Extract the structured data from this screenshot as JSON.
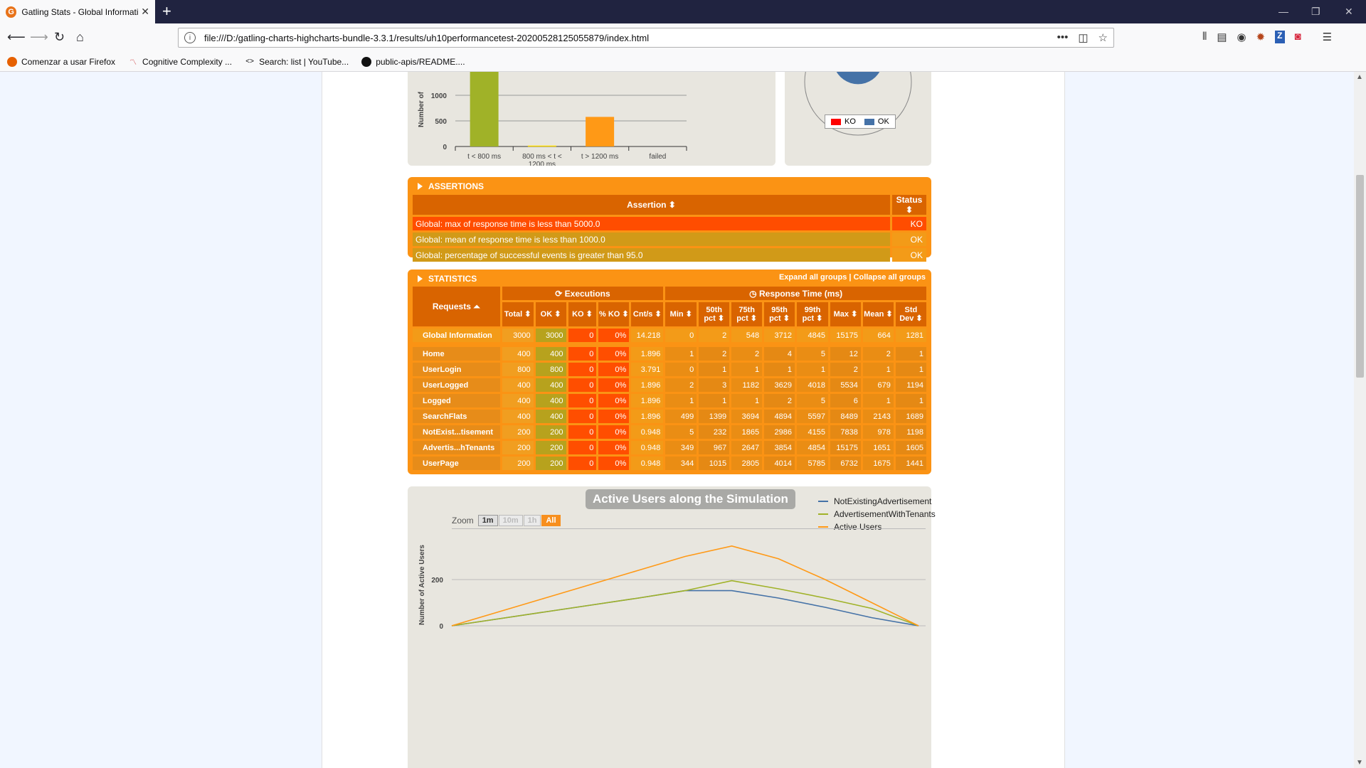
{
  "browser": {
    "tab_title": "Gatling Stats - Global Informati",
    "tab_favicon": "G",
    "url": "file:///D:/gatling-charts-highcharts-bundle-3.3.1/results/uh10performancetest-20200528125055879/index.html",
    "bookmarks": [
      {
        "label": "Comenzar a usar Firefox",
        "icon": "firefox-icon"
      },
      {
        "label": "Cognitive Complexity ...",
        "icon": "sonar-icon"
      },
      {
        "label": "Search: list | YouTube...",
        "icon": "code-icon"
      },
      {
        "label": "public-apis/README....",
        "icon": "github-icon"
      }
    ]
  },
  "distribution_chart": {
    "type": "bar",
    "ylabel": "Number of",
    "y_ticks": [
      "0",
      "500",
      "1000"
    ],
    "categories": [
      "t < 800 ms",
      "800 ms < t < 1200 ms",
      "t > 1200 ms",
      "failed"
    ],
    "category_lines": [
      [
        "t < 800 ms"
      ],
      [
        "800 ms < t <",
        "1200 ms"
      ],
      [
        "t > 1200 ms"
      ],
      [
        "failed"
      ]
    ],
    "values": [
      2404,
      18,
      578,
      0
    ],
    "colors": [
      "#a0b228",
      "#ffdd00",
      "#ff9916",
      "#f15b4f"
    ],
    "ylim": [
      0,
      1500
    ]
  },
  "pie_legend": {
    "ko": "KO",
    "ok": "OK",
    "ko_color": "#ff0000",
    "ok_color": "#4572a7"
  },
  "assertions": {
    "title": "ASSERTIONS",
    "header_assertion": "Assertion ⬍",
    "header_status": "Status ⬍",
    "rows": [
      {
        "text": "Global: max of response time is less than 5000.0",
        "status": "KO"
      },
      {
        "text": "Global: mean of response time is less than 1000.0",
        "status": "OK"
      },
      {
        "text": "Global: percentage of successful events is greater than 95.0",
        "status": "OK"
      }
    ]
  },
  "statistics": {
    "title": "STATISTICS",
    "expand": "Expand all groups",
    "sep": "|",
    "collapse": "Collapse all groups",
    "group_executions": "Executions",
    "group_response": "Response Time (ms)",
    "requests_header": "Requests ⏶",
    "columns": [
      "Total ⬍",
      "OK ⬍",
      "KO ⬍",
      "% KO ⬍",
      "Cnt/s ⬍",
      "Min ⬍",
      "50th pct ⬍",
      "75th pct ⬍",
      "95th pct ⬍",
      "99th pct ⬍",
      "Max ⬍",
      "Mean ⬍",
      "Std Dev ⬍"
    ],
    "column_lines": [
      [
        "Total ⬍"
      ],
      [
        "OK ⬍"
      ],
      [
        "KO ⬍"
      ],
      [
        "% KO ⬍"
      ],
      [
        "Cnt/s ⬍"
      ],
      [
        "Min ⬍"
      ],
      [
        "50th",
        "pct ⬍"
      ],
      [
        "75th",
        "pct ⬍"
      ],
      [
        "95th",
        "pct ⬍"
      ],
      [
        "99th",
        "pct ⬍"
      ],
      [
        "Max ⬍"
      ],
      [
        "Mean ⬍"
      ],
      [
        "Std",
        "Dev ⬍"
      ]
    ],
    "global_row": {
      "name": "Global Information",
      "cells": [
        "3000",
        "3000",
        "0",
        "0%",
        "14.218",
        "0",
        "2",
        "548",
        "3712",
        "4845",
        "15175",
        "664",
        "1281"
      ]
    },
    "rows": [
      {
        "name": "Home",
        "cells": [
          "400",
          "400",
          "0",
          "0%",
          "1.896",
          "1",
          "2",
          "2",
          "4",
          "5",
          "12",
          "2",
          "1"
        ]
      },
      {
        "name": "UserLogin",
        "cells": [
          "800",
          "800",
          "0",
          "0%",
          "3.791",
          "0",
          "1",
          "1",
          "1",
          "1",
          "2",
          "1",
          "1"
        ]
      },
      {
        "name": "UserLogged",
        "cells": [
          "400",
          "400",
          "0",
          "0%",
          "1.896",
          "2",
          "3",
          "1182",
          "3629",
          "4018",
          "5534",
          "679",
          "1194"
        ]
      },
      {
        "name": "Logged",
        "cells": [
          "400",
          "400",
          "0",
          "0%",
          "1.896",
          "1",
          "1",
          "1",
          "2",
          "5",
          "6",
          "1",
          "1"
        ]
      },
      {
        "name": "SearchFlats",
        "cells": [
          "400",
          "400",
          "0",
          "0%",
          "1.896",
          "499",
          "1399",
          "3694",
          "4894",
          "5597",
          "8489",
          "2143",
          "1689"
        ]
      },
      {
        "name": "NotExist...tisement",
        "cells": [
          "200",
          "200",
          "0",
          "0%",
          "0.948",
          "5",
          "232",
          "1865",
          "2986",
          "4155",
          "7838",
          "978",
          "1198"
        ]
      },
      {
        "name": "Advertis...hTenants",
        "cells": [
          "200",
          "200",
          "0",
          "0%",
          "0.948",
          "349",
          "967",
          "2647",
          "3854",
          "4854",
          "15175",
          "1651",
          "1605"
        ]
      },
      {
        "name": "UserPage",
        "cells": [
          "200",
          "200",
          "0",
          "0%",
          "0.948",
          "344",
          "1015",
          "2805",
          "4014",
          "5785",
          "6732",
          "1675",
          "1441"
        ]
      }
    ]
  },
  "active_users": {
    "title": "Active Users along the Simulation",
    "zoom_label": "Zoom",
    "zoom_buttons": [
      {
        "label": "1m",
        "state": "normal"
      },
      {
        "label": "10m",
        "state": "disabled"
      },
      {
        "label": "1h",
        "state": "disabled"
      },
      {
        "label": "All",
        "state": "selected"
      }
    ],
    "ylabel": "Number of Active Users",
    "y_ticks": [
      "0",
      "200"
    ],
    "legend": [
      {
        "name": "NotExistingAdvertisement",
        "color": "#4572a7"
      },
      {
        "name": "AdvertisementWithTenants",
        "color": "#a0b228"
      },
      {
        "name": "Active Users",
        "color": "#ff9916"
      }
    ]
  },
  "chart_data": [
    {
      "type": "bar",
      "categories": [
        "t < 800 ms",
        "800 ms < t < 1200 ms",
        "t > 1200 ms",
        "failed"
      ],
      "values": [
        2404,
        18,
        578,
        0
      ],
      "ylabel": "Number of",
      "ylim": [
        0,
        1500
      ]
    },
    {
      "type": "line",
      "title": "Active Users along the Simulation",
      "ylabel": "Number of Active Users",
      "x": [
        0,
        1,
        2,
        3,
        4,
        5,
        6,
        7,
        8,
        9,
        10
      ],
      "series": [
        {
          "name": "NotExistingAdvertisement",
          "values": [
            0,
            30,
            60,
            90,
            120,
            152,
            152,
            120,
            80,
            35,
            0
          ]
        },
        {
          "name": "AdvertisementWithTenants",
          "values": [
            0,
            30,
            60,
            90,
            120,
            152,
            195,
            160,
            120,
            75,
            0
          ]
        },
        {
          "name": "Active Users",
          "values": [
            0,
            60,
            120,
            180,
            240,
            300,
            345,
            290,
            200,
            100,
            0
          ]
        }
      ],
      "ylim": [
        0,
        420
      ]
    }
  ]
}
